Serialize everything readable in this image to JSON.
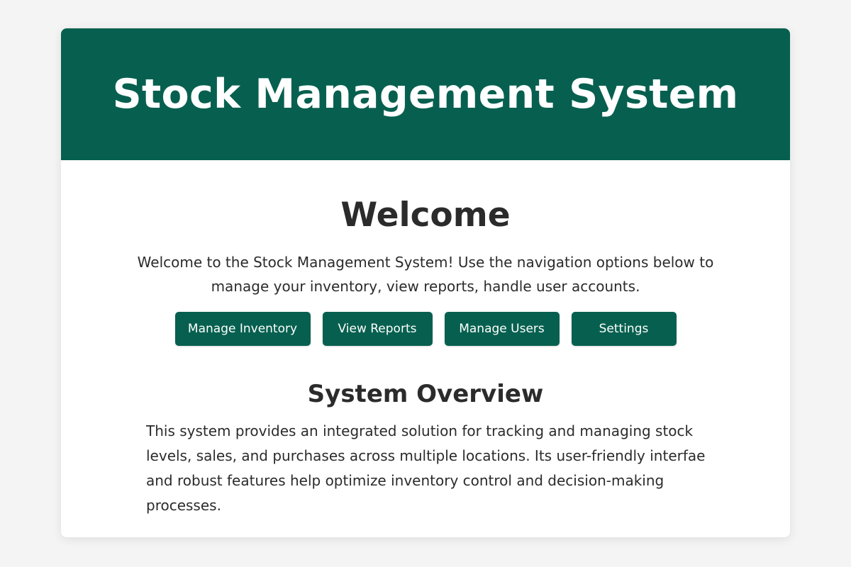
{
  "colors": {
    "brand": "#07604f",
    "background": "#f4f4f4",
    "card": "#ffffff",
    "text": "#2b2b2b"
  },
  "header": {
    "title": "Stock Management System"
  },
  "welcome": {
    "heading": "Welcome",
    "text": "Welcome to the Stock Management System! Use the navigation options below to manage your inventory, view reports, handle user accounts."
  },
  "nav": {
    "manage_inventory": "Manage Inventory",
    "view_reports": "View Reports",
    "manage_users": "Manage Users",
    "settings": "Settings"
  },
  "overview": {
    "heading": "System Overview",
    "text": "This system provides an integrated solution for tracking and managing stock levels, sales, and purchases across multiple locations. Its user-friendly interfae and robust features help optimize inventory control and decision-making processes."
  }
}
